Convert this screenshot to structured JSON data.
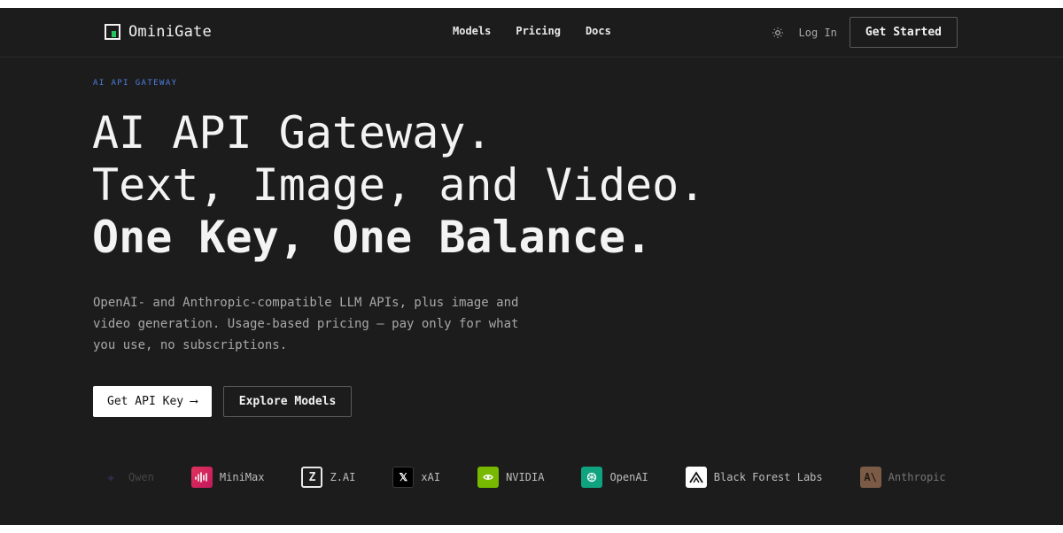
{
  "nav": {
    "brand": "OminiGate",
    "links": [
      "Models",
      "Pricing",
      "Docs"
    ],
    "login": "Log In",
    "get_started": "Get Started"
  },
  "hero": {
    "eyebrow": "AI API GATEWAY",
    "headline": [
      "AI API Gateway.",
      "Text, Image, and Video.",
      "One Key, One Balance."
    ],
    "subtext": "OpenAI- and Anthropic-compatible LLM APIs, plus image and video generation. Usage-based pricing — pay only for what you use, no subscriptions.",
    "primary_button": "Get API Key ⟶",
    "secondary_button": "Explore Models"
  },
  "providers": [
    {
      "name": "Qwen",
      "icon": "qwen-icon",
      "color": "#6b5bd6",
      "glyph": "✦"
    },
    {
      "name": "MiniMax",
      "icon": "minimax-icon",
      "color": "#e0335e",
      "glyph": ""
    },
    {
      "name": "Z.AI",
      "icon": "zai-icon",
      "color": "#ffffff",
      "glyph": "Z"
    },
    {
      "name": "xAI",
      "icon": "xai-icon",
      "color": "#000000",
      "glyph": "X"
    },
    {
      "name": "NVIDIA",
      "icon": "nvidia-icon",
      "color": "#76b900",
      "glyph": ""
    },
    {
      "name": "OpenAI",
      "icon": "openai-icon",
      "color": "#10a37f",
      "glyph": ""
    },
    {
      "name": "Black Forest Labs",
      "icon": "black-forest-labs-icon",
      "color": "#ffffff",
      "glyph": ""
    },
    {
      "name": "Anthropic",
      "icon": "anthropic-icon",
      "color": "#c9906a",
      "glyph": "A\\"
    }
  ],
  "colors": {
    "background": "#1d1c1c",
    "accent": "#4a7fe0",
    "brand_dot": "#22c55e"
  }
}
